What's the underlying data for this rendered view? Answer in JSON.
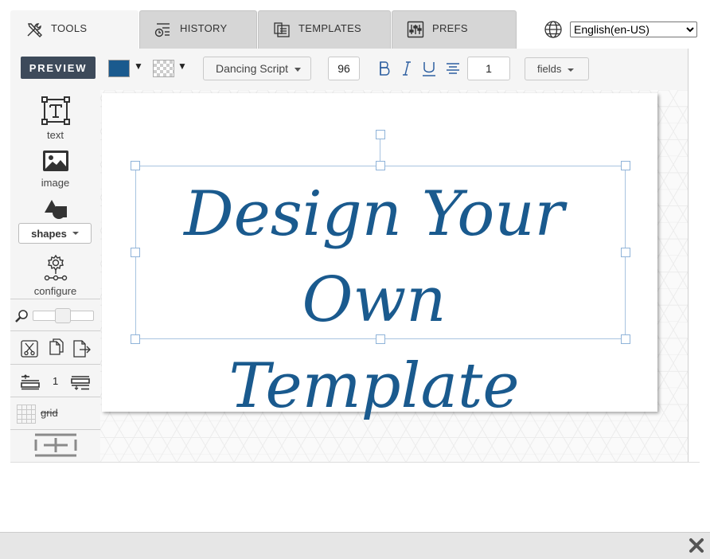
{
  "tabs": [
    {
      "label": "TOOLS",
      "icon": "tools-icon",
      "active": true
    },
    {
      "label": "HISTORY",
      "icon": "history-icon",
      "active": false
    },
    {
      "label": "TEMPLATES",
      "icon": "templates-icon",
      "active": false
    },
    {
      "label": "PREFS",
      "icon": "sliders-icon",
      "active": false
    }
  ],
  "language": {
    "selected": "English(en-US)",
    "icon": "globe-icon"
  },
  "toolbar": {
    "preview_label": "PREVIEW",
    "fill_color": "#1a5a8e",
    "background_color": "transparent",
    "font_family": "Dancing Script",
    "font_size": "96",
    "line_spacing": "1",
    "fields_label": "fields"
  },
  "sidebar": {
    "text_label": "text",
    "image_label": "image",
    "shapes_label": "shapes",
    "configure_label": "configure",
    "zoom_level": 0.5,
    "layer_index": "1",
    "grid_label": "grid"
  },
  "canvas": {
    "text_line_1": "Design Your",
    "text_line_2": "Own Template",
    "text_color": "#1a5a8e"
  }
}
